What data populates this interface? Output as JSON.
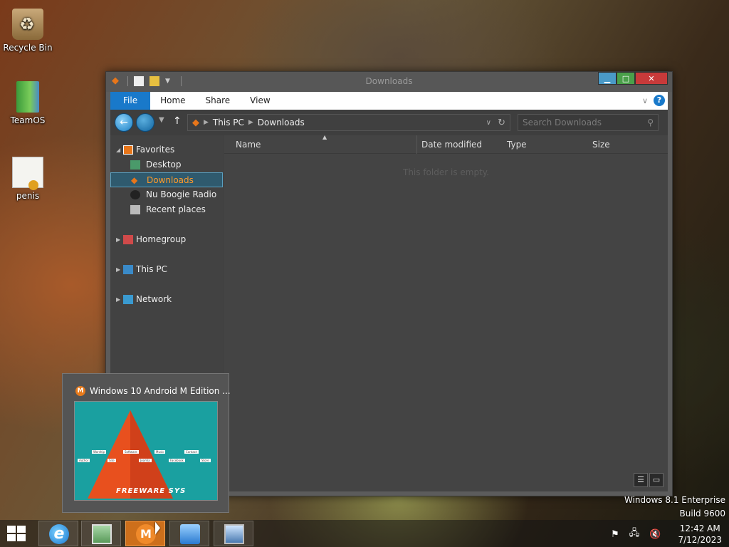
{
  "desktop": {
    "icons": [
      {
        "label": "Recycle Bin"
      },
      {
        "label": "TeamOS"
      },
      {
        "label": "penis"
      }
    ]
  },
  "window": {
    "title": "Downloads",
    "ribbon_tabs": [
      "File",
      "Home",
      "Share",
      "View"
    ],
    "help_label": "?",
    "address": {
      "root": "This PC",
      "current": "Downloads"
    },
    "search_placeholder": "Search Downloads",
    "nav_pane": {
      "favorites": {
        "label": "Favorites",
        "items": [
          "Desktop",
          "Downloads",
          "Nu Boogie Radio",
          "Recent places"
        ],
        "selected": "Downloads"
      },
      "groups": [
        "Homegroup",
        "This PC",
        "Network"
      ]
    },
    "columns": [
      "Name",
      "Date modified",
      "Type",
      "Size"
    ],
    "empty_text": "This folder is empty."
  },
  "thumbnail": {
    "title": "Windows 10 Android M Edition ...",
    "preview": {
      "labels": [
        "Worship",
        "Software",
        "Music",
        "Contact",
        "Author",
        "Site",
        "Joomla",
        "Facebook",
        "Store"
      ],
      "logo_text": "FREEWARE SYS"
    }
  },
  "watermark": {
    "line1": "Windows 8.1 Enterprise",
    "line2": "Build 9600"
  },
  "taskbar": {
    "clock": {
      "time": "12:42 AM",
      "date": "7/12/2023"
    }
  },
  "colors": {
    "accent": "#1979ca",
    "selection_text": "#ff9a2a",
    "active_task": "#e87a1a"
  }
}
